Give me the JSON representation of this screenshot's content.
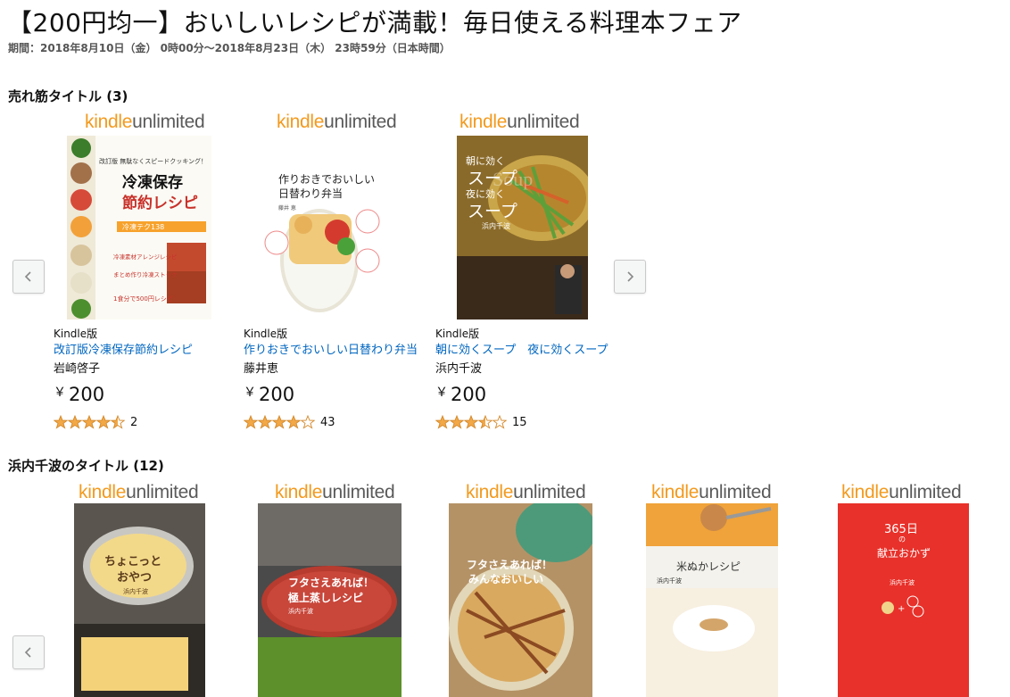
{
  "header": {
    "title": "【200円均一】おいしいレシピが満載！毎日使える料理本フェア",
    "period": "期間：2018年8月10日（金） 0時00分〜2018年8月23日（木） 23時59分（日本時間）"
  },
  "logo": {
    "kindle": "kindle",
    "unlimited": "unlimited"
  },
  "sections": [
    {
      "title": "売れ筋タイトル (3)",
      "books": [
        {
          "format": "Kindle版",
          "title": "改訂版冷凍保存節約レシピ",
          "author": "岩崎啓子",
          "price_symbol": "￥",
          "price": "200",
          "rating": 4.5,
          "review_count": "2",
          "cover_texts": [
            "冷凍保存",
            "節約レシピ",
            "改訂版 無駄なくスピードクッキング！",
            "冷凍テク138",
            "冷凍素材アレンジレシピ",
            "まとめ作り冷凍ストック",
            "1食分で500円レシピ"
          ]
        },
        {
          "format": "Kindle版",
          "title": "作りおきでおいしい日替わり弁当",
          "author": "藤井恵",
          "price_symbol": "￥",
          "price": "200",
          "rating": 4.0,
          "review_count": "43",
          "cover_texts": [
            "作りおきでおいしい",
            "日替わり弁当",
            "藤井 恵"
          ]
        },
        {
          "format": "Kindle版",
          "title": "朝に効くスープ　夜に効くスープ",
          "author": "浜内千波",
          "price_symbol": "￥",
          "price": "200",
          "rating": 3.5,
          "review_count": "15",
          "cover_texts": [
            "朝に効く",
            "スープ",
            "夜に効く",
            "スープ",
            "浜内千波",
            "Soup"
          ]
        }
      ]
    },
    {
      "title": "浜内千波のタイトル (12)",
      "books": [
        {
          "cover_texts": [
            "ちょこっと",
            "おやつ",
            "浜内千波"
          ]
        },
        {
          "cover_texts": [
            "フタさえあれば！",
            "極上蒸しレシピ",
            "浜内千波"
          ]
        },
        {
          "cover_texts": [
            "フタさえあれば！",
            "みんなおいしい"
          ]
        },
        {
          "cover_texts": [
            "米ぬかレシピ",
            "浜内千波"
          ]
        },
        {
          "cover_texts": [
            "365日",
            "の",
            "献立おかず",
            "浜内千波"
          ]
        }
      ]
    }
  ],
  "colors": {
    "link": "#0066c0",
    "star": "#f3a847",
    "kindle_orange": "#f39a1e",
    "unlimited_gray": "#5a5a5a",
    "button_bg": "#f5f6f6"
  },
  "icons": {
    "prev": "chevron-left-icon",
    "next": "chevron-right-icon",
    "star_full": "star-full-icon",
    "star_half": "star-half-icon",
    "star_empty": "star-empty-icon"
  }
}
